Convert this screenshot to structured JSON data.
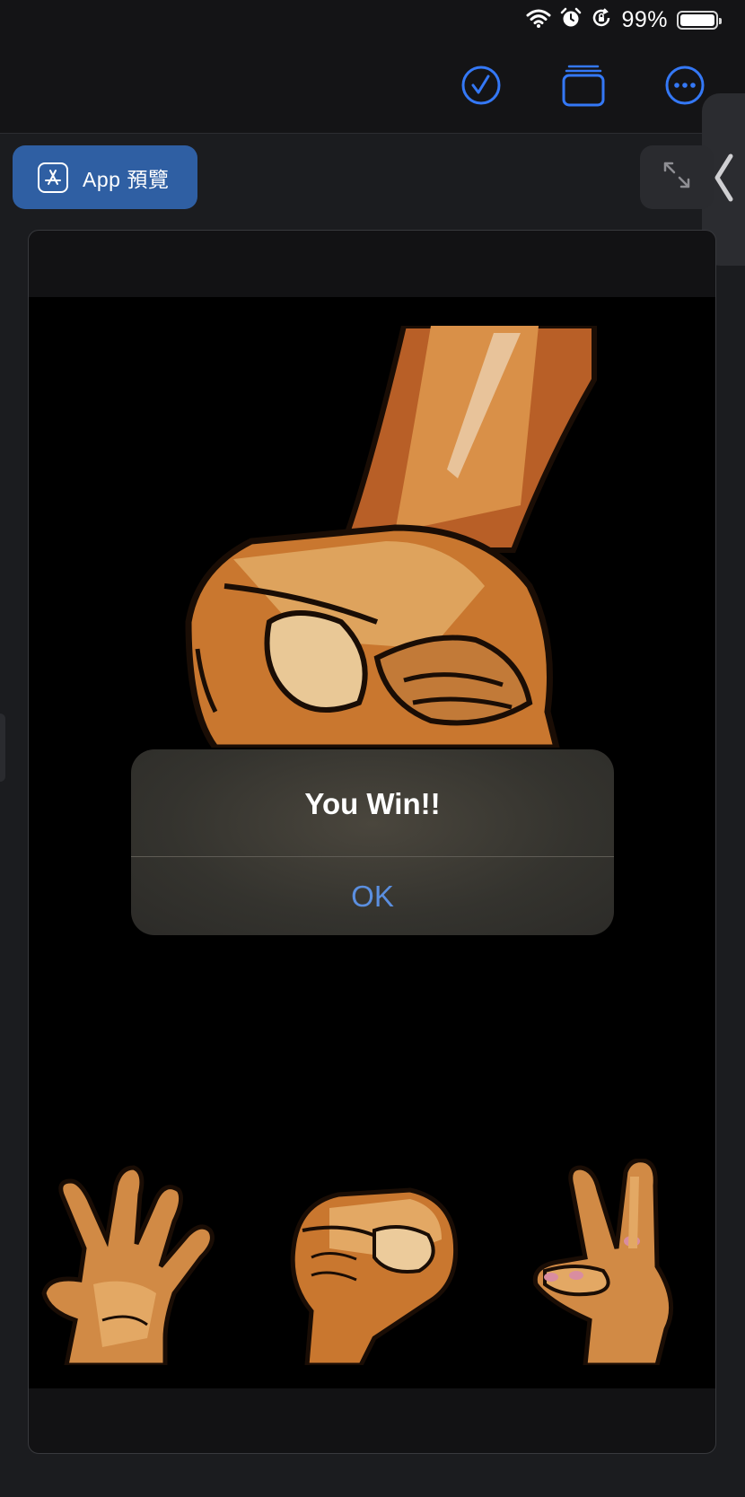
{
  "status_bar": {
    "battery_percent": "99%",
    "battery_level": 0.99,
    "icons": [
      "wifi-icon",
      "alarm-icon",
      "rotation-lock-icon",
      "battery-icon"
    ]
  },
  "toolbar": {
    "icons": [
      "checkmark-circle-icon",
      "stack-icon",
      "more-icon",
      "chevron-left-icon"
    ]
  },
  "preview": {
    "app_preview_label": "App 預覽",
    "expand_icon": "expand-arrows-icon"
  },
  "game": {
    "computer_choice": "rock",
    "player_choices": [
      "paper",
      "rock",
      "scissors"
    ]
  },
  "alert": {
    "title": "You Win!!",
    "ok_label": "OK"
  },
  "colors": {
    "accent": "#3478f6",
    "app_preview_bg": "#2f5fa3",
    "alert_ok": "#5b8fe0",
    "skin": "#d18a45",
    "skin_shadow": "#a8521f"
  }
}
